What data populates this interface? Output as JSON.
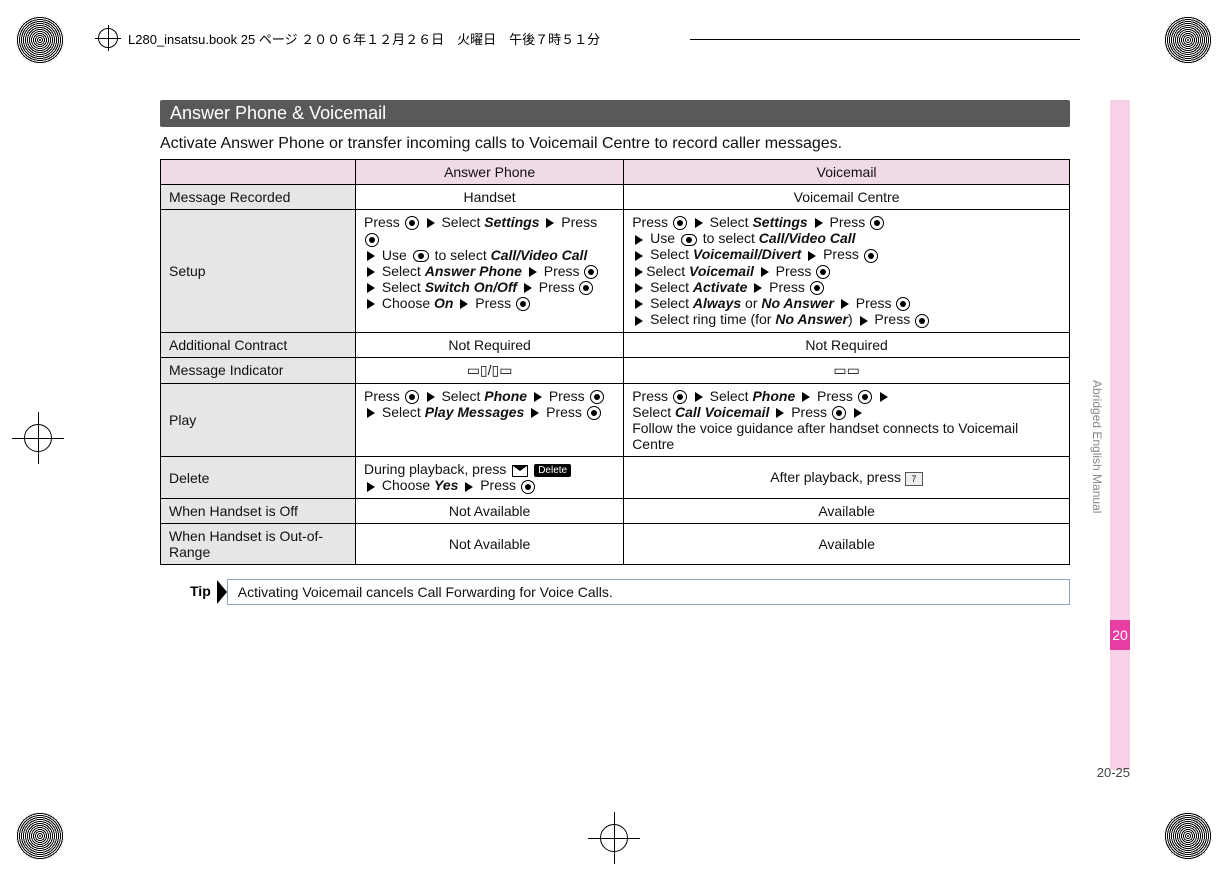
{
  "header_meta": "L280_insatsu.book 25 ページ ２００６年１２月２６日　火曜日　午後７時５１分",
  "section_title": "Answer Phone & Voicemail",
  "intro": "Activate Answer Phone or transfer incoming calls to Voicemail Centre to record caller messages.",
  "cols": {
    "c1": "Answer Phone",
    "c2": "Voicemail"
  },
  "rows": {
    "message_recorded": {
      "label": "Message Recorded",
      "c1": "Handset",
      "c2": "Voicemail Centre"
    },
    "setup": {
      "label": "Setup",
      "c1": {
        "a": "Press ",
        "b": " Select ",
        "settings": "Settings",
        "c": " Press ",
        "d": " Use ",
        "e": " to select  ",
        "cvc": "Call/Video Call",
        "f": " Select ",
        "ap": "Answer Phone",
        "g": " Press ",
        "h": " Select ",
        "soo": "Switch On/Off",
        "i": " Press ",
        "j": " Choose ",
        "on": "On",
        "k": " Press "
      },
      "c2": {
        "a": "Press ",
        "b": " Select ",
        "settings": "Settings",
        "c": " Press ",
        "d": " Use ",
        "e": " to select ",
        "cvc": "Call/Video Call",
        "f": " Select ",
        "vd": "Voicemail/Divert",
        "g": " Press ",
        "h": "Select ",
        "vm": "Voicemail",
        "i": " Press ",
        "j": " Select ",
        "act": "Activate",
        "k": " Press ",
        "l": " Select ",
        "always": "Always",
        "or": " or ",
        "noanswer": "No Answer",
        "m": " Press ",
        "n": " Select ring time (for ",
        "noanswer2": "No Answer",
        "o": ") ",
        "p": " Press "
      }
    },
    "additional_contract": {
      "label": "Additional Contract",
      "c1": "Not Required",
      "c2": "Not Required"
    },
    "message_indicator": {
      "label": "Message Indicator"
    },
    "play": {
      "label": "Play",
      "c1": {
        "a": "Press ",
        "b": " Select ",
        "phone": "Phone",
        "c": " Press ",
        "d": " Select ",
        "pm": "Play Messages",
        "e": " Press "
      },
      "c2": {
        "a": "Press ",
        "b": " Select ",
        "phone": "Phone",
        "c": " Press ",
        "d": "Select ",
        "cv": "Call Voicemail",
        "e": " Press ",
        "f": "Follow the voice guidance after handset connects to Voicemail Centre"
      }
    },
    "delete": {
      "label": "Delete",
      "c1": {
        "a": "During playback, press ",
        "del": "Delete",
        "b": " Choose ",
        "yes": "Yes",
        "c": " Press "
      },
      "c2": {
        "a": "After playback, press ",
        "key": "7"
      }
    },
    "handset_off": {
      "label": "When Handset is Off",
      "c1": "Not Available",
      "c2": "Available"
    },
    "out_of_range": {
      "label": "When Handset is Out-of-Range",
      "c1": "Not Available",
      "c2": "Available"
    }
  },
  "tip": {
    "label": "Tip",
    "text": "Activating Voicemail cancels Call Forwarding for Voice Calls."
  },
  "side": {
    "label": "Abridged English Manual",
    "chapter": "20"
  },
  "pagenum": "20-25"
}
